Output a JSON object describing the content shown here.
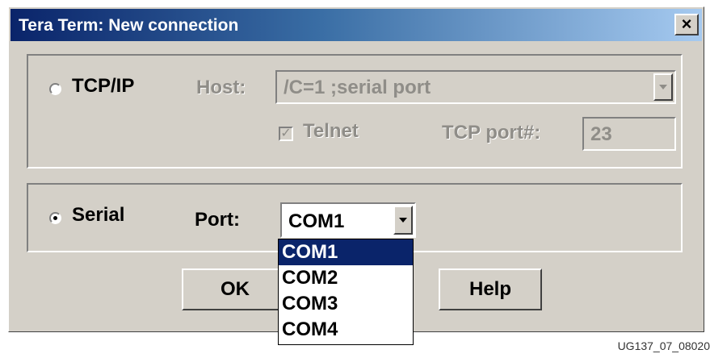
{
  "window": {
    "title": "Tera Term: New connection",
    "close_label": "×"
  },
  "tcpip": {
    "label": "TCP/IP",
    "selected": false,
    "host_label": "Host:",
    "host_value": "/C=1 ;serial port",
    "telnet_label": "Telnet",
    "telnet_checked": true,
    "tcp_port_label": "TCP port#:",
    "tcp_port_value": "23"
  },
  "serial": {
    "label": "Serial",
    "selected": true,
    "port_label": "Port:",
    "port_value": "COM1",
    "port_options": [
      "COM1",
      "COM2",
      "COM3",
      "COM4"
    ],
    "highlighted_option": "COM1"
  },
  "buttons": {
    "ok": "OK",
    "help": "Help"
  },
  "figure_id": "UG137_07_08020"
}
